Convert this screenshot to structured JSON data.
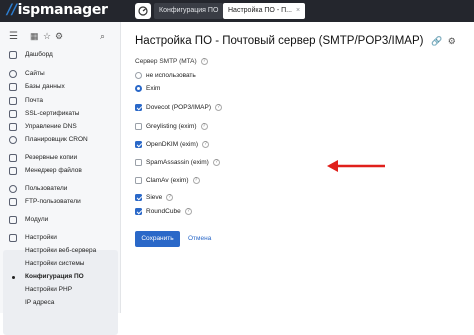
{
  "app": {
    "logo": "ispmanager"
  },
  "tabs": [
    {
      "label": "Конфигурация ПО"
    },
    {
      "label": "Настройка ПО - П...",
      "close": "×"
    }
  ],
  "sidebar": {
    "items": [
      {
        "label": "Дашборд"
      },
      {
        "label": "Сайты"
      },
      {
        "label": "Базы данных"
      },
      {
        "label": "Почта"
      },
      {
        "label": "SSL-сертификаты"
      },
      {
        "label": "Управление DNS"
      },
      {
        "label": "Планировщик CRON"
      },
      {
        "label": "Резервные копии"
      },
      {
        "label": "Менеджер файлов"
      },
      {
        "label": "Пользователи"
      },
      {
        "label": "FTP-пользователи"
      },
      {
        "label": "Модули"
      },
      {
        "label": "Настройки"
      },
      {
        "label": "Настройки веб-сервера"
      },
      {
        "label": "Настройки системы"
      },
      {
        "label": "Конфигурация ПО"
      },
      {
        "label": "Настройки PHP"
      },
      {
        "label": "IP адреса"
      }
    ]
  },
  "main": {
    "title": "Настройка ПО - Почтовый сервер (SMTP/POP3/IMAP)",
    "mta_label": "Сервер SMTP (MTA)",
    "radios": [
      {
        "label": "не использовать",
        "checked": false
      },
      {
        "label": "Exim",
        "checked": true
      }
    ],
    "checkboxes": [
      {
        "label": "Dovecot (POP3/IMAP)",
        "checked": true
      },
      {
        "label": "Greylisting (exim)",
        "checked": false
      },
      {
        "label": "OpenDKIM (exim)",
        "checked": true
      },
      {
        "label": "SpamAssassin (exim)",
        "checked": false
      },
      {
        "label": "ClamAv (exim)",
        "checked": false
      },
      {
        "label": "Sieve",
        "checked": true
      },
      {
        "label": "RoundCube",
        "checked": true
      }
    ],
    "save_label": "Сохранить",
    "cancel_label": "Отмена"
  },
  "colors": {
    "accent": "#2a68c8",
    "topbar": "#24262d",
    "arrow": "#e0201b"
  }
}
